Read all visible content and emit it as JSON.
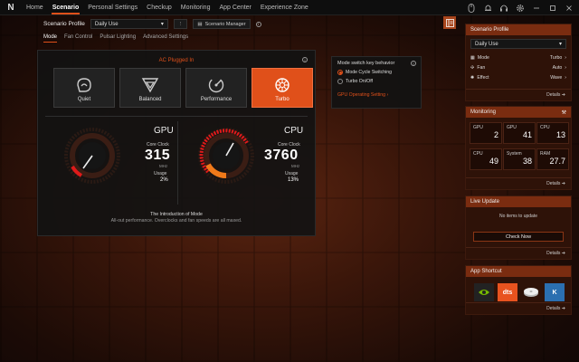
{
  "nav": {
    "logo": "N",
    "items": [
      "Home",
      "Scenario",
      "Personal Settings",
      "Checkup",
      "Monitoring",
      "App Center",
      "Experience Zone"
    ],
    "active": 1
  },
  "scenario": {
    "label": "Scenario Profile",
    "value": "Daily Use",
    "manager": "Scenario Manager"
  },
  "subtabs": [
    "Mode",
    "Fan Control",
    "Pulsar Lighting",
    "Advanced Settings"
  ],
  "power": {
    "status": "AC Plugged In"
  },
  "modes": [
    {
      "label": "Quiet",
      "icon": "quiet-icon"
    },
    {
      "label": "Balanced",
      "icon": "balanced-icon"
    },
    {
      "label": "Performance",
      "icon": "performance-icon"
    },
    {
      "label": "Turbo",
      "icon": "turbo-icon",
      "active": true
    }
  ],
  "gpu": {
    "title": "GPU",
    "clock_label": "Core Clock",
    "clock": "315",
    "unit": "MHz",
    "usage_label": "Usage",
    "usage": "2%",
    "usage_fraction": 0.02
  },
  "cpu": {
    "title": "CPU",
    "clock_label": "Core Clock",
    "clock": "3760",
    "unit": "MHz",
    "usage_label": "Usage",
    "usage": "13%",
    "usage_fraction": 0.13
  },
  "intro": {
    "title": "The Introduction of Mode",
    "text": "All-out performance. Overclocks and fan speeds are all maxed."
  },
  "switch": {
    "title": "Mode switch key behavior",
    "opt1": "Mode Cycle Switching",
    "opt2": "Turbo On/Off",
    "gpu_link": "GPU Operating Setting"
  },
  "right": {
    "profile": {
      "title": "Scenario Profile",
      "value": "Daily Use",
      "rows": [
        {
          "k": "Mode",
          "v": "Turbo"
        },
        {
          "k": "Fan",
          "v": "Auto"
        },
        {
          "k": "Effect",
          "v": "Wave"
        }
      ],
      "details": "Details"
    },
    "monitoring": {
      "title": "Monitoring",
      "cells": [
        {
          "k": "GPU",
          "v": "2"
        },
        {
          "k": "GPU",
          "v": "41"
        },
        {
          "k": "CPU",
          "v": "13"
        },
        {
          "k": "CPU",
          "v": "49"
        },
        {
          "k": "System",
          "v": "38"
        },
        {
          "k": "RAM",
          "v": "27.7"
        }
      ],
      "details": "Details"
    },
    "live": {
      "title": "Live Update",
      "empty": "No items to update",
      "btn": "Check Now",
      "details": "Details"
    },
    "apps": {
      "title": "App Shortcut",
      "items": [
        "dts"
      ],
      "details": "Details"
    }
  }
}
